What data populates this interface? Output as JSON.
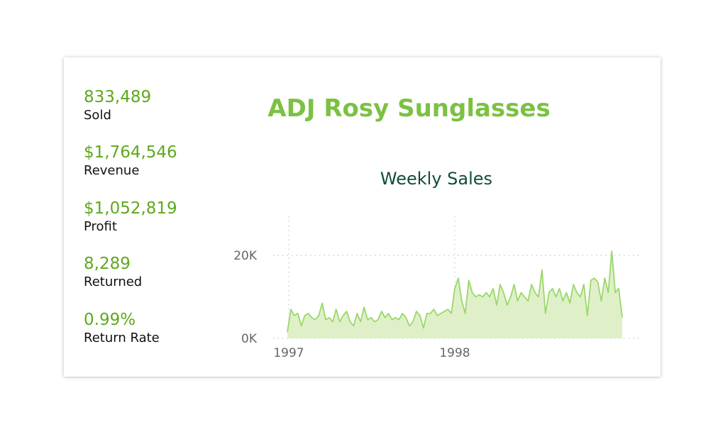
{
  "kpis": [
    {
      "value": "833,489",
      "label": "Sold"
    },
    {
      "value": "$1,764,546",
      "label": "Revenue"
    },
    {
      "value": "$1,052,819",
      "label": "Profit"
    },
    {
      "value": "8,289",
      "label": "Returned"
    },
    {
      "value": "0.99%",
      "label": "Return Rate"
    }
  ],
  "title": "ADJ Rosy Sunglasses",
  "colors": {
    "kpi_value": "#5fa81d",
    "title": "#7cc142",
    "chart_title": "#124c3a",
    "area_fill": "#dff0c8",
    "area_line": "#9ad86a"
  },
  "chart_data": {
    "type": "area",
    "title": "Weekly Sales",
    "xlabel": "",
    "ylabel": "",
    "x_ticks": [
      "1997",
      "1998"
    ],
    "y_ticks": [
      "0K",
      "20K"
    ],
    "ylim": [
      0,
      30000
    ],
    "grid": true,
    "series": [
      {
        "values": [
          1500,
          7000,
          5500,
          6000,
          3000,
          5500,
          6000,
          5000,
          4500,
          5500,
          8500,
          4500,
          5000,
          4000,
          7000,
          4000,
          5500,
          6500,
          4000,
          3000,
          6000,
          4000,
          7500,
          4500,
          5000,
          4000,
          4500,
          6500,
          5000,
          6000,
          4500,
          5000,
          4500,
          6000,
          5000,
          3000,
          4000,
          6500,
          5500,
          2500,
          6000,
          6000,
          7000,
          5500,
          6000,
          6500,
          7000,
          6000,
          12000,
          14500,
          9000,
          6000,
          14000,
          11000,
          10000,
          10500,
          10000,
          11000,
          10000,
          12000,
          8000,
          13000,
          11000,
          8000,
          10000,
          13000,
          9000,
          11000,
          10000,
          9000,
          13000,
          11000,
          10000,
          16500,
          6000,
          11000,
          12000,
          10000,
          12000,
          9000,
          11000,
          8500,
          13000,
          11000,
          10000,
          13000,
          5500,
          14000,
          14500,
          13500,
          9000,
          14500,
          11000,
          21000,
          11000,
          12000,
          5000
        ]
      }
    ]
  }
}
